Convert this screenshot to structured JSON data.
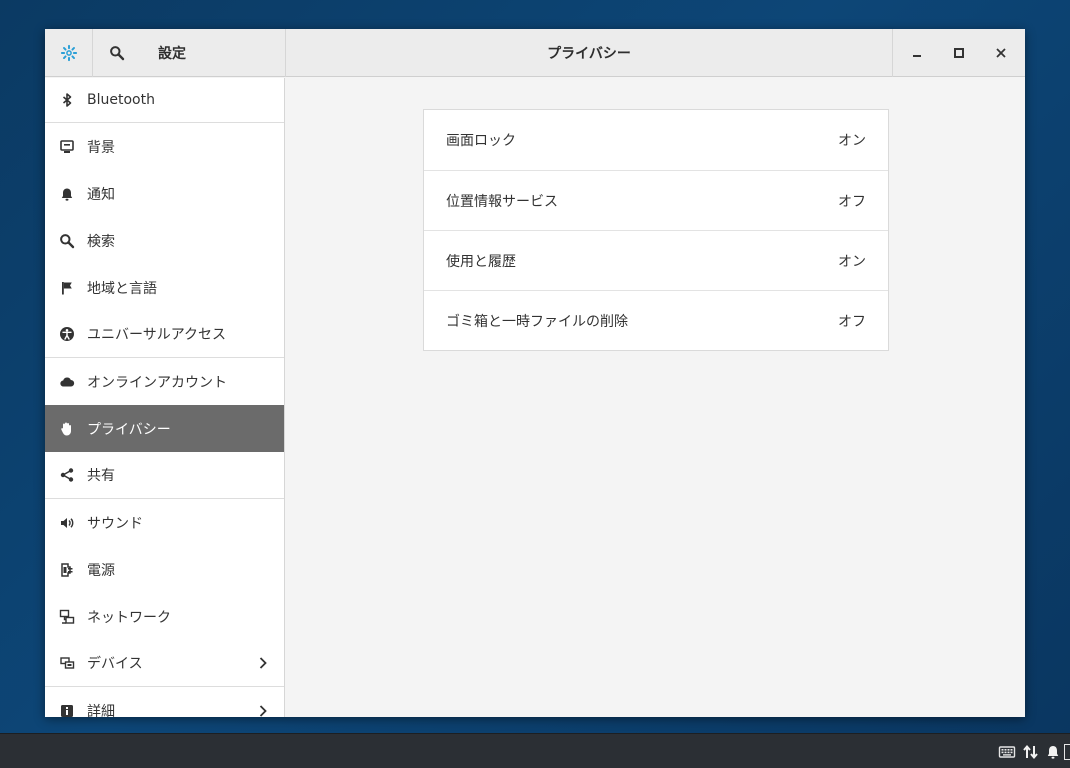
{
  "titlebar": {
    "settings_label": "設定",
    "page_title": "プライバシー",
    "icons": [
      "gear-icon",
      "search-icon",
      "minimize-icon",
      "maximize-icon",
      "close-icon"
    ]
  },
  "sidebar": {
    "items": [
      {
        "label": "Bluetooth",
        "icon": "bluetooth-icon"
      },
      {
        "label": "背景",
        "icon": "background-icon"
      },
      {
        "label": "通知",
        "icon": "bell-icon"
      },
      {
        "label": "検索",
        "icon": "search-icon"
      },
      {
        "label": "地域と言語",
        "icon": "flag-icon"
      },
      {
        "label": "ユニバーサルアクセス",
        "icon": "accessibility-icon"
      },
      {
        "label": "オンラインアカウント",
        "icon": "cloud-icon"
      },
      {
        "label": "プライバシー",
        "icon": "hand-icon",
        "selected": true
      },
      {
        "label": "共有",
        "icon": "share-icon"
      },
      {
        "label": "サウンド",
        "icon": "speaker-icon"
      },
      {
        "label": "電源",
        "icon": "power-plug-icon"
      },
      {
        "label": "ネットワーク",
        "icon": "network-icon"
      },
      {
        "label": "デバイス",
        "icon": "devices-icon"
      },
      {
        "label": "詳細",
        "icon": "info-icon"
      }
    ]
  },
  "privacy": {
    "rows": [
      {
        "label": "画面ロック",
        "value": "オン"
      },
      {
        "label": "位置情報サービス",
        "value": "オフ"
      },
      {
        "label": "使用と履歴",
        "value": "オン"
      },
      {
        "label": "ゴミ箱と一時ファイルの削除",
        "value": "オフ"
      }
    ]
  },
  "taskbar": {
    "tray_icons": [
      "keyboard-icon",
      "network-arrows-icon",
      "notification-bell-icon"
    ]
  },
  "colors": {
    "accent": "#2a9fd6",
    "selected_bg": "#6b6b6b",
    "desktop": "#0d4677",
    "taskbar": "#2b2f34"
  }
}
